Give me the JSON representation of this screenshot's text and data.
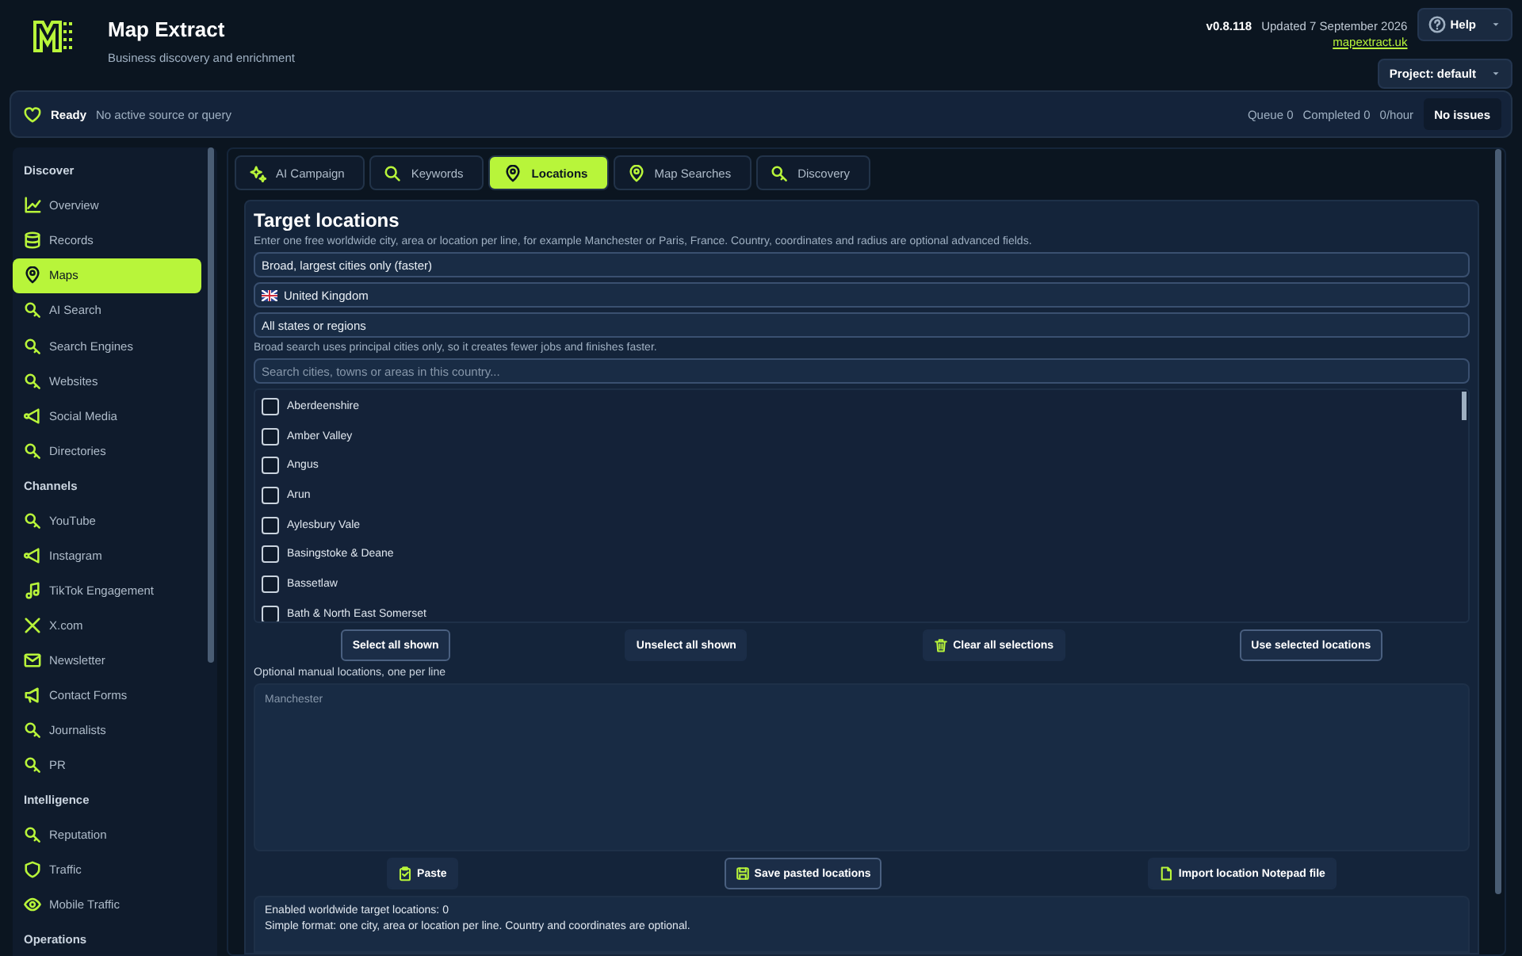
{
  "app": {
    "title": "Map Extract",
    "subtitle": "Business discovery and enrichment",
    "version": "v0.8.118",
    "updated": "Updated 7 September 2026",
    "link": "mapextract.uk"
  },
  "header_buttons": [
    {
      "label": "Help",
      "kind": "help"
    },
    {
      "label": "Project: default",
      "kind": "project"
    }
  ],
  "status_bar": {
    "state": "Ready",
    "message": "No active source or query",
    "queue": "Queue 0",
    "completed": "Completed 0",
    "rate": "0/hour",
    "issues": "No issues"
  },
  "sidebar": [
    {
      "heading": "Discover",
      "items": [
        {
          "label": "Overview",
          "selected": false
        },
        {
          "label": "Records",
          "selected": false
        },
        {
          "label": "Maps",
          "selected": true
        },
        {
          "label": "AI Search",
          "selected": false
        },
        {
          "label": "Search Engines",
          "selected": false
        },
        {
          "label": "Websites",
          "selected": false
        },
        {
          "label": "Social Media",
          "selected": false
        },
        {
          "label": "Directories",
          "selected": false
        }
      ]
    },
    {
      "heading": "Channels",
      "items": [
        {
          "label": "YouTube",
          "selected": false
        },
        {
          "label": "Instagram",
          "selected": false
        },
        {
          "label": "TikTok Engagement",
          "selected": false
        },
        {
          "label": "X.com",
          "selected": false
        },
        {
          "label": "Newsletter",
          "selected": false
        },
        {
          "label": "Contact Forms",
          "selected": false
        },
        {
          "label": "Journalists",
          "selected": false
        },
        {
          "label": "PR",
          "selected": false
        }
      ]
    },
    {
      "heading": "Intelligence",
      "items": [
        {
          "label": "Reputation",
          "selected": false
        },
        {
          "label": "Traffic",
          "selected": false
        },
        {
          "label": "Mobile Traffic",
          "selected": false
        }
      ]
    },
    {
      "heading": "Operations"
    }
  ],
  "tabs": [
    {
      "label": "AI Campaign",
      "selected": false
    },
    {
      "label": "Keywords",
      "selected": false
    },
    {
      "label": "Locations",
      "selected": true
    },
    {
      "label": "Map Searches",
      "selected": false
    },
    {
      "label": "Discovery",
      "selected": false
    }
  ],
  "panel": {
    "title": "Target locations",
    "intro": "Enter one free worldwide city, area or location per line, for example Manchester or Paris, France. Country, coordinates and radius are optional advanced fields.",
    "selects": [
      {
        "value": "Broad, largest cities only (faster)",
        "flag": false
      },
      {
        "value": "United Kingdom",
        "flag": true
      },
      {
        "value": "All states or regions",
        "flag": false
      }
    ],
    "hint": "Broad search uses principal cities only, so it creates fewer jobs and finishes faster.",
    "search": {
      "placeholder": "Search cities, towns or areas in this country..."
    },
    "regions": [
      {
        "label": "Aberdeenshire",
        "checked": false
      },
      {
        "label": "Amber Valley",
        "checked": false
      },
      {
        "label": "Angus",
        "checked": false
      },
      {
        "label": "Arun",
        "checked": false
      },
      {
        "label": "Aylesbury Vale",
        "checked": false
      },
      {
        "label": "Basingstoke & Deane",
        "checked": false
      },
      {
        "label": "Bassetlaw",
        "checked": false
      },
      {
        "label": "Bath & North East Somerset",
        "checked": false
      }
    ],
    "list_buttons": [
      {
        "label": "Select all shown",
        "kind": "outlined"
      },
      {
        "label": "Unselect all shown",
        "kind": "plain"
      },
      {
        "label": "Clear all selections",
        "kind": "trash"
      },
      {
        "label": "Use selected locations",
        "kind": "outlined"
      }
    ],
    "manual_label": "Optional manual locations, one per line",
    "manual": {
      "placeholder": "Manchester"
    },
    "paste_buttons": [
      {
        "label": "Paste",
        "kind": "clipboard"
      },
      {
        "label": "Save pasted locations",
        "kind": "save"
      },
      {
        "label": "Import location Notepad file",
        "kind": "file"
      }
    ],
    "summary": [
      "Enabled worldwide target locations: 0",
      "Simple format: one city, area or location per line. Country and coordinates are optional."
    ]
  }
}
